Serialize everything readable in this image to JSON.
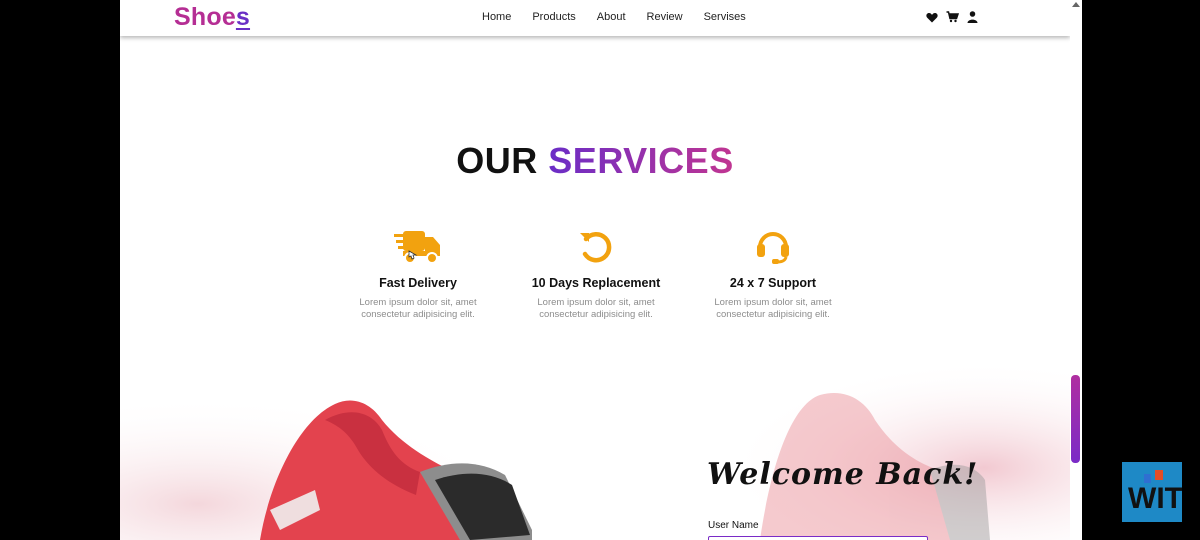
{
  "navbar": {
    "logo_main": "Shoe",
    "logo_last": "s",
    "links": [
      "Home",
      "Products",
      "About",
      "Review",
      "Servises"
    ],
    "icons": [
      "heart-icon",
      "cart-icon",
      "user-icon"
    ]
  },
  "services": {
    "title_part1": "OUR",
    "title_part2": "SERVICES",
    "items": [
      {
        "title": "Fast Delivery",
        "text_line1": "Lorem ipsum dolor sit, amet",
        "text_line2": "consectetur adipisicing elit.",
        "icon": "delivery-truck-icon"
      },
      {
        "title": "10 Days Replacement",
        "text_line1": "Lorem ipsum dolor sit, amet",
        "text_line2": "consectetur adipisicing elit.",
        "icon": "replacement-icon"
      },
      {
        "title": "24 x 7 Support",
        "text_line1": "Lorem ipsum dolor sit, amet",
        "text_line2": "consectetur adipisicing elit.",
        "icon": "headset-icon"
      }
    ]
  },
  "login": {
    "welcome": "Welcome Back!",
    "username_label": "User Name"
  },
  "colors": {
    "accent_purple": "#6a2dc7",
    "accent_magenta": "#c13591",
    "icon_orange": "#f2a20f"
  },
  "watermark": {
    "text": "WIT"
  }
}
